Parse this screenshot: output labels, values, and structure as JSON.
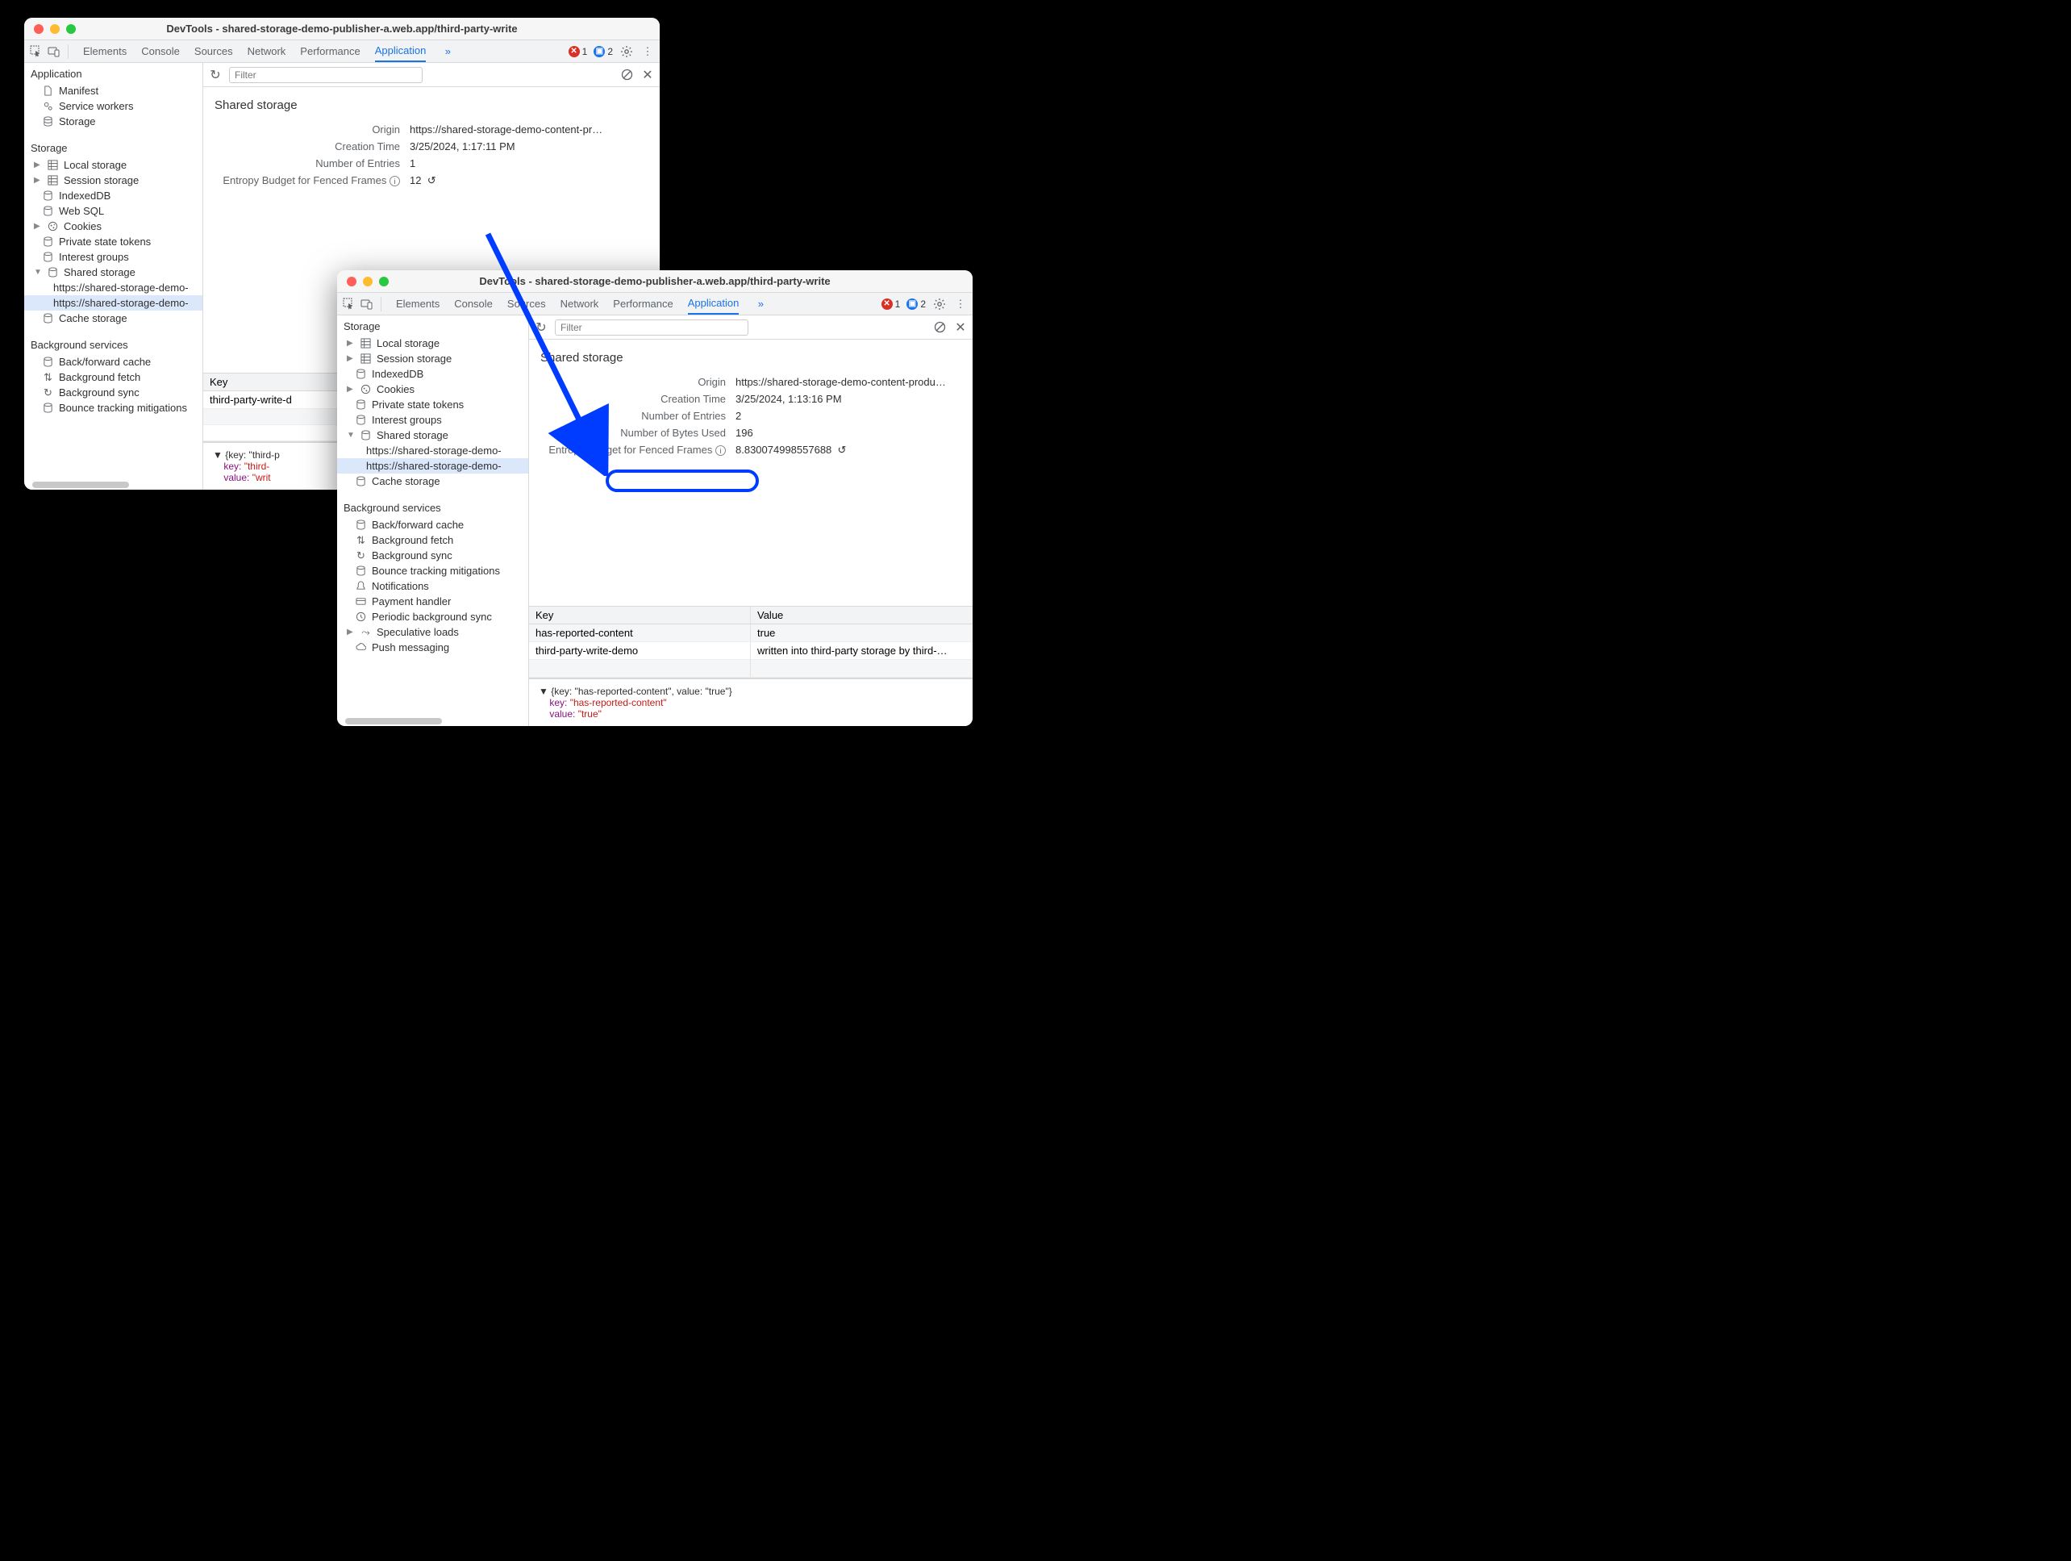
{
  "windows": {
    "a": {
      "title": "DevTools - shared-storage-demo-publisher-a.web.app/third-party-write",
      "tabs": [
        "Elements",
        "Console",
        "Sources",
        "Network",
        "Performance",
        "Application"
      ],
      "activeTab": "Application",
      "errors": "1",
      "infos": "2",
      "filter_placeholder": "Filter",
      "sidebar": {
        "application": "Application",
        "manifest": "Manifest",
        "service_workers": "Service workers",
        "storage_root": "Storage",
        "storage": "Storage",
        "local": "Local storage",
        "session": "Session storage",
        "indexed": "IndexedDB",
        "websql": "Web SQL",
        "cookies": "Cookies",
        "pst": "Private state tokens",
        "ig": "Interest groups",
        "shared": "Shared storage",
        "ss_a": "https://shared-storage-demo-",
        "ss_b": "https://shared-storage-demo-",
        "cache": "Cache storage",
        "bg": "Background services",
        "bfc": "Back/forward cache",
        "bgf": "Background fetch",
        "bgs": "Background sync",
        "btm": "Bounce tracking mitigations"
      },
      "panel": {
        "title": "Shared storage",
        "origin_k": "Origin",
        "origin_v": "https://shared-storage-demo-content-pr…",
        "ct_k": "Creation Time",
        "ct_v": "3/25/2024, 1:17:11 PM",
        "ne_k": "Number of Entries",
        "ne_v": "1",
        "eb_k": "Entropy Budget for Fenced Frames",
        "eb_v": "12"
      },
      "table": {
        "key_h": "Key",
        "row_key": "third-party-write-d"
      },
      "detail": {
        "l1": "▼ {key: \"third-p",
        "l2k": "key: ",
        "l2v": "\"third-",
        "l3k": "value: ",
        "l3v": "\"writ"
      }
    },
    "b": {
      "title": "DevTools - shared-storage-demo-publisher-a.web.app/third-party-write",
      "tabs": [
        "Elements",
        "Console",
        "Sources",
        "Network",
        "Performance",
        "Application"
      ],
      "activeTab": "Application",
      "errors": "1",
      "infos": "2",
      "filter_placeholder": "Filter",
      "sidebar": {
        "storage": "Storage",
        "local": "Local storage",
        "session": "Session storage",
        "indexed": "IndexedDB",
        "cookies": "Cookies",
        "pst": "Private state tokens",
        "ig": "Interest groups",
        "shared": "Shared storage",
        "ss_a": "https://shared-storage-demo-",
        "ss_b": "https://shared-storage-demo-",
        "cache": "Cache storage",
        "bg": "Background services",
        "bfc": "Back/forward cache",
        "bgf": "Background fetch",
        "bgs": "Background sync",
        "btm": "Bounce tracking mitigations",
        "notif": "Notifications",
        "pay": "Payment handler",
        "pbs": "Periodic background sync",
        "spec": "Speculative loads",
        "push": "Push messaging"
      },
      "panel": {
        "title": "Shared storage",
        "origin_k": "Origin",
        "origin_v": "https://shared-storage-demo-content-produ…",
        "ct_k": "Creation Time",
        "ct_v": "3/25/2024, 1:13:16 PM",
        "ne_k": "Number of Entries",
        "ne_v": "2",
        "nb_k": "Number of Bytes Used",
        "nb_v": "196",
        "eb_k": "Entropy Budget for Fenced Frames",
        "eb_v": "8.830074998557688"
      },
      "table": {
        "key_h": "Key",
        "val_h": "Value",
        "r1k": "has-reported-content",
        "r1v": "true",
        "r2k": "third-party-write-demo",
        "r2v": "written into third-party storage by third-…"
      },
      "detail": {
        "l1": "▼ {key: \"has-reported-content\", value: \"true\"}",
        "l2k": "key: ",
        "l2v": "\"has-reported-content\"",
        "l3k": "value: ",
        "l3v": "\"true\""
      }
    }
  }
}
